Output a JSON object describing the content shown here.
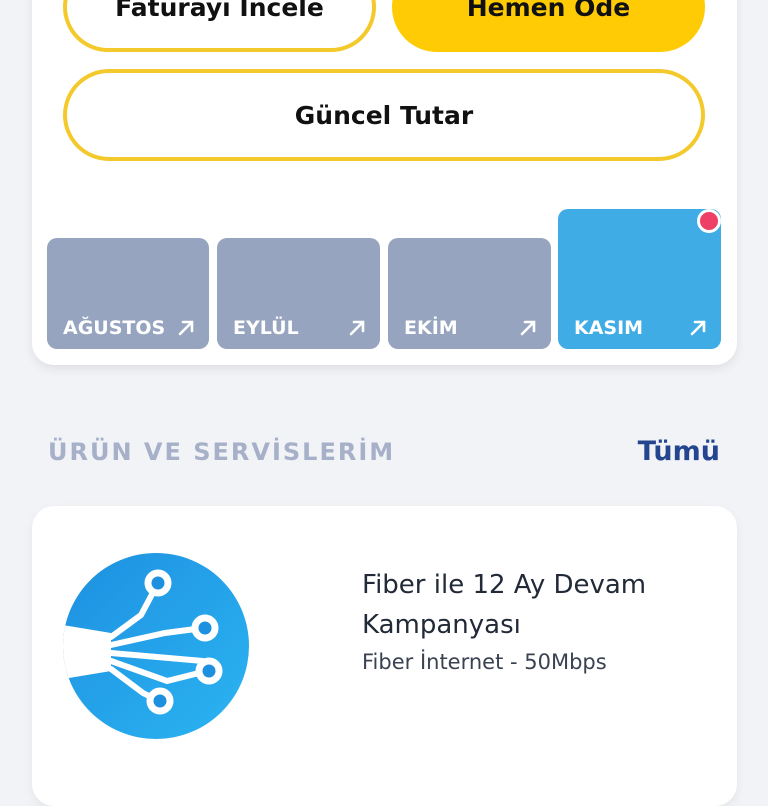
{
  "bill": {
    "review_label": "Faturayı İncele",
    "pay_label": "Hemen Öde",
    "current_amount_label": "Güncel Tutar"
  },
  "months": [
    {
      "label": "AĞUSTOS"
    },
    {
      "label": "EYLÜL"
    },
    {
      "label": "EKİM"
    },
    {
      "label": "KASIM"
    }
  ],
  "colors": {
    "accent_yellow": "#ffcb05",
    "month_inactive": "#96a4bf",
    "month_active": "#40ace6",
    "notification": "#ee3f67",
    "link_blue": "#24468f"
  },
  "products": {
    "section_title": "ÜRÜN VE SERVİSLERİM",
    "see_all_label": "Tümü",
    "items": [
      {
        "title": "Fiber ile 12 Ay Devam Kampanyası",
        "subtitle": "Fiber İnternet - 50Mbps",
        "icon": "fiber-icon"
      }
    ]
  }
}
